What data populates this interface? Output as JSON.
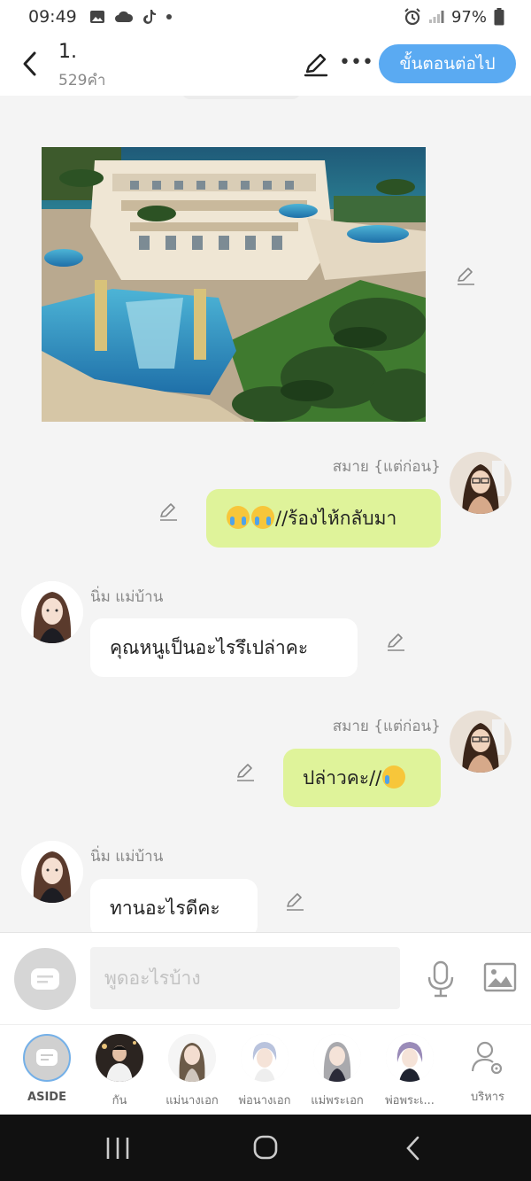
{
  "status": {
    "time": "09:49",
    "battery": "97%",
    "icons": [
      "image-icon",
      "cloud-icon",
      "tiktok-icon",
      "dot-icon",
      "alarm-icon",
      "signal-icon",
      "battery-icon"
    ]
  },
  "header": {
    "title": "1.",
    "word_count": "529คำ",
    "next_label": "ขั้นตอนต่อไป"
  },
  "messages": [
    {
      "type": "image",
      "description_icon": "mansion-photo"
    },
    {
      "side": "mine",
      "sender": "สมาย {แต่ก่อน}",
      "text": "//ร้องไห้กลับมา",
      "emojis": [
        "crying-face",
        "crying-face"
      ]
    },
    {
      "side": "theirs",
      "sender": "นิ่ม แม่บ้าน",
      "text": "คุณหนูเป็นอะไรรึเปล่าคะ"
    },
    {
      "side": "mine",
      "sender": "สมาย {แต่ก่อน}",
      "text": "ปล่าวคะ//",
      "emojis": [
        "tear-smile-face"
      ]
    },
    {
      "side": "theirs",
      "sender": "นิ่ม แม่บ้าน",
      "text": "ทานอะไรดีคะ"
    }
  ],
  "input": {
    "placeholder": "พูดอะไรบ้าง",
    "value": ""
  },
  "characters": [
    {
      "label": "ASIDE"
    },
    {
      "label": "กัน"
    },
    {
      "label": "แม่นางเอก"
    },
    {
      "label": "พ่อนางเอก"
    },
    {
      "label": "แม่พระเอก"
    },
    {
      "label": "พ่อพระเ..."
    },
    {
      "label": "บริหาร"
    }
  ],
  "colors": {
    "accent": "#5aaaf2",
    "mine_bubble": "#dff39a",
    "theirs_bubble": "#ffffff",
    "background": "#f4f4f4"
  }
}
